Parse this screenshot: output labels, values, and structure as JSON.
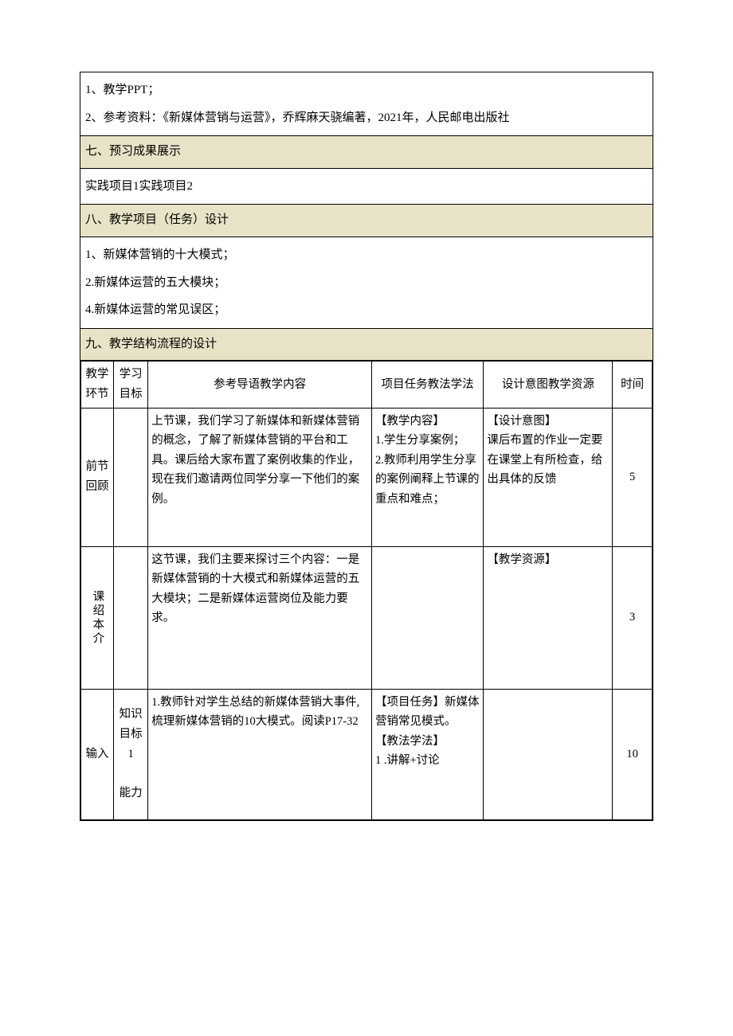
{
  "materials": {
    "line1": "1、教学PPT；",
    "line2": "2、参考资料：《新媒体营销与运营》，乔辉麻天骁编著，2021年，人民邮电出版社"
  },
  "section7": {
    "title": "七、预习成果展示",
    "content": "实践项目1实践项目2"
  },
  "section8": {
    "title": "八、教学项目（任务）设计",
    "line1": "1、新媒体营销的十大模式；",
    "line2": "2.新媒体运营的五大模块；",
    "line3": "4.新媒体运营的常见误区；"
  },
  "section9": {
    "title": "九、教学结构流程的设计",
    "headers": {
      "stage": "教学环节",
      "goal": "学习目标",
      "script": "参考导语教学内容",
      "task": "项目任务教法学法",
      "design": "设计意图教学资源",
      "time": "时间"
    },
    "rows": [
      {
        "stage": "前节回顾",
        "goal": "",
        "script": "上节课，我们学习了新媒体和新媒体营销的概念，了解了新媒体营销的平台和工具。课后给大家布置了案例收集的作业，现在我们邀请两位同学分享一下他们的案例。",
        "task": "【教学内容】\n1.学生分享案例；\n2.教师利用学生分享的案例阐释上节课的重点和难点；",
        "design": "【设计意图】\n课后布置的作业一定要在课堂上有所检查，给出具体的反馈",
        "time": "5"
      },
      {
        "stage": "课绍本介",
        "goal": "",
        "script": "这节课，我们主要来探讨三个内容：一是新媒体营销的十大模式和新媒体运营的五大模块；二是新媒体运营岗位及能力要求。",
        "task": "",
        "design": "【教学资源】",
        "time": "3"
      },
      {
        "stage": "输入",
        "goal": "知识目标1\n\n能力",
        "script": "1.教师针对学生总结的新媒体营销大事件,梳理新媒体营销的10大模式。阅读P17-32",
        "task": "【项目任务】新媒体营销常见模式。\n【教法学法】\n1        .讲解+讨论",
        "design": "",
        "time": "10"
      }
    ]
  }
}
